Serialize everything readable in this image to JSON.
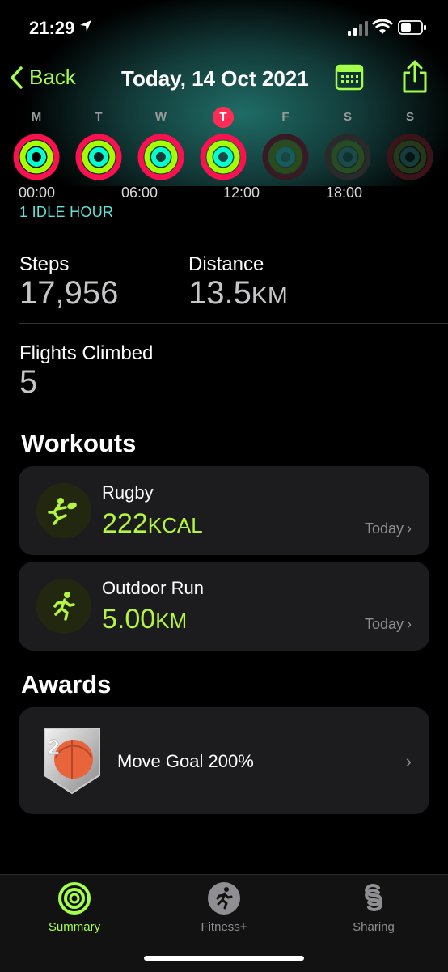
{
  "status_bar": {
    "time": "21:29"
  },
  "nav": {
    "back_label": "Back",
    "title": "Today, 14 Oct 2021"
  },
  "week": [
    {
      "letter": "M",
      "today": false,
      "future": false
    },
    {
      "letter": "T",
      "today": false,
      "future": false
    },
    {
      "letter": "W",
      "today": false,
      "future": false
    },
    {
      "letter": "T",
      "today": true,
      "future": false
    },
    {
      "letter": "F",
      "today": false,
      "future": true
    },
    {
      "letter": "S",
      "today": false,
      "future": true
    },
    {
      "letter": "S",
      "today": false,
      "future": true
    }
  ],
  "timeline": {
    "labels": [
      "00:00",
      "06:00",
      "12:00",
      "18:00"
    ],
    "idle": "1 IDLE HOUR"
  },
  "stats": {
    "steps_label": "Steps",
    "steps_value": "17,956",
    "distance_label": "Distance",
    "distance_value": "13.5",
    "distance_unit": "KM",
    "flights_label": "Flights Climbed",
    "flights_value": "5"
  },
  "workouts": {
    "title": "Workouts",
    "items": [
      {
        "name": "Rugby",
        "value": "222",
        "unit": "KCAL",
        "date": "Today",
        "icon": "rugby-icon"
      },
      {
        "name": "Outdoor Run",
        "value": "5.00",
        "unit": "KM",
        "date": "Today",
        "icon": "running-icon"
      }
    ]
  },
  "awards": {
    "title": "Awards",
    "items": [
      {
        "name": "Move Goal 200%",
        "icon": "move-goal-badge-icon"
      }
    ]
  },
  "tabbar": {
    "items": [
      {
        "label": "Summary",
        "active": true,
        "icon": "activity-rings-icon"
      },
      {
        "label": "Fitness+",
        "active": false,
        "icon": "fitness-plus-icon"
      },
      {
        "label": "Sharing",
        "active": false,
        "icon": "sharing-icon"
      }
    ]
  },
  "colors": {
    "accent": "#a4ff4a",
    "move_ring": "#fa114f",
    "exercise_ring": "#a6ff00",
    "stand_ring": "#00ffd1",
    "today_badge": "#ff2d55",
    "idle_text": "#5fe3d6"
  }
}
